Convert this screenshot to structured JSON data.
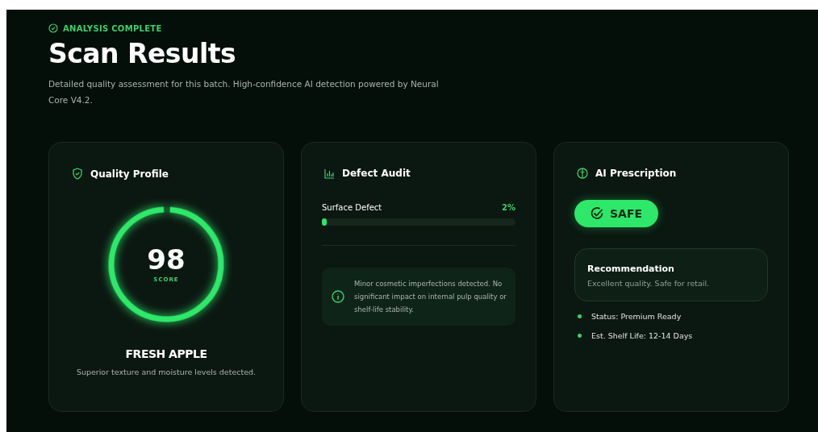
{
  "header": {
    "status": "ANALYSIS COMPLETE",
    "title": "Scan Results",
    "description": "Detailed quality assessment for this batch. High-confidence AI detection powered by Neural Core V4.2."
  },
  "quality_profile": {
    "title": "Quality Profile",
    "score": "98",
    "score_label": "SCORE",
    "product": "FRESH APPLE",
    "note": "Superior texture and moisture levels detected."
  },
  "defect_audit": {
    "title": "Defect Audit",
    "metrics": [
      {
        "label": "Surface Defect",
        "value": "2%",
        "level": 0.02
      }
    ],
    "info": "Minor cosmetic imperfections detected. No significant impact on internal pulp quality or shelf-life stability."
  },
  "ai_prescription": {
    "title": "AI Prescription",
    "verdict": "SAFE",
    "recommendation": {
      "title": "Recommendation",
      "text": "Excellent quality. Safe for retail."
    },
    "facts": [
      "Status: Premium Ready",
      "Est. Shelf Life: 12-14 Days"
    ]
  }
}
